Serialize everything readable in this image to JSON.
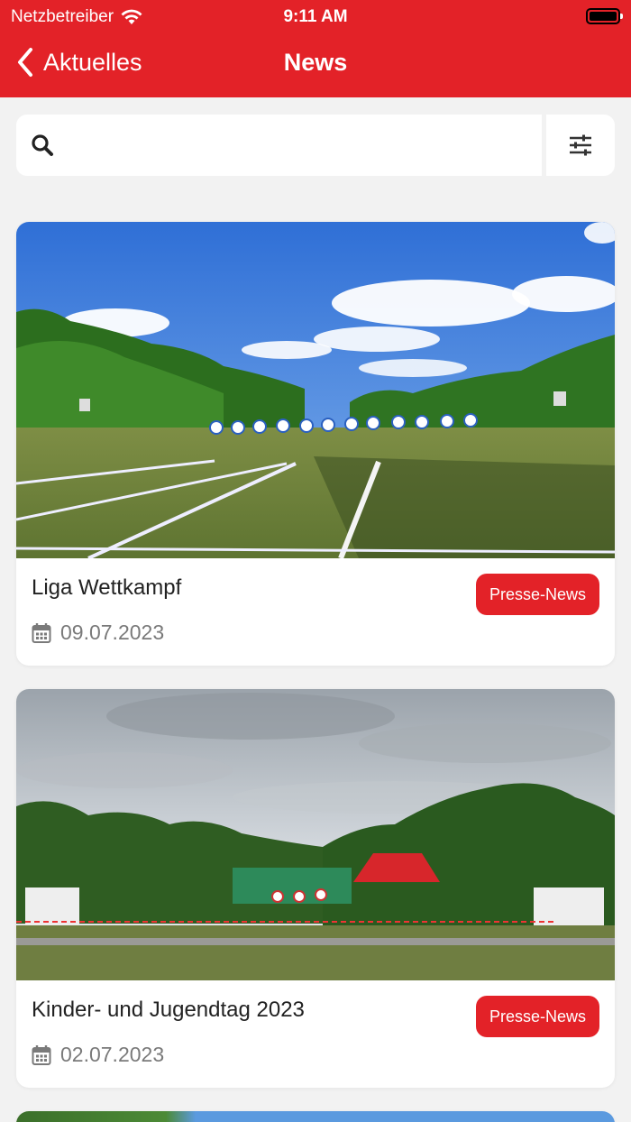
{
  "status_bar": {
    "carrier": "Netzbetreiber",
    "time": "9:11 AM"
  },
  "nav": {
    "back_label": "Aktuelles",
    "title": "News"
  },
  "search": {
    "placeholder": "",
    "value": ""
  },
  "colors": {
    "brand_red": "#e32228",
    "background": "#f2f2f2"
  },
  "news": [
    {
      "title": "Liga Wettkampf",
      "date": "09.07.2023",
      "badge": "Presse-News"
    },
    {
      "title": "Kinder- und Jugendtag 2023",
      "date": "02.07.2023",
      "badge": "Presse-News"
    }
  ]
}
